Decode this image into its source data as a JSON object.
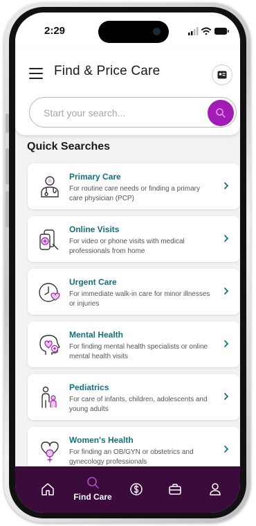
{
  "status_bar": {
    "time": "2:29"
  },
  "header": {
    "title": "Find & Price Care",
    "search_placeholder": "Start your search..."
  },
  "quick_searches": {
    "title": "Quick Searches",
    "items": [
      {
        "title": "Primary Care",
        "description": "For routine care needs or finding a primary care physician (PCP)",
        "icon": "doctor-icon"
      },
      {
        "title": "Online Visits",
        "description": "For video or phone visits with medical professionals from home",
        "icon": "online-visit-icon"
      },
      {
        "title": "Urgent Care",
        "description": "For immediate walk-in care for minor illnesses or injuries",
        "icon": "clock-heart-icon"
      },
      {
        "title": "Mental Health",
        "description": "For finding mental health specialists or online mental health visits",
        "icon": "head-heart-icon"
      },
      {
        "title": "Pediatrics",
        "description": "For care of infants, children, adolescents and young adults",
        "icon": "parent-child-icon"
      },
      {
        "title": "Women's Health",
        "description": "For finding an OB/GYN or obstetrics and gynecology professionals",
        "icon": "female-heart-icon"
      }
    ]
  },
  "bottom_nav": {
    "items": [
      {
        "label": "",
        "icon": "home-icon"
      },
      {
        "label": "Find Care",
        "icon": "search-icon",
        "active": true
      },
      {
        "label": "",
        "icon": "dollar-icon"
      },
      {
        "label": "",
        "icon": "briefcase-icon"
      },
      {
        "label": "",
        "icon": "profile-icon"
      }
    ]
  },
  "colors": {
    "accent": "#a21bb5",
    "nav_bg": "#3b0b3b",
    "title_teal": "#12717a"
  }
}
